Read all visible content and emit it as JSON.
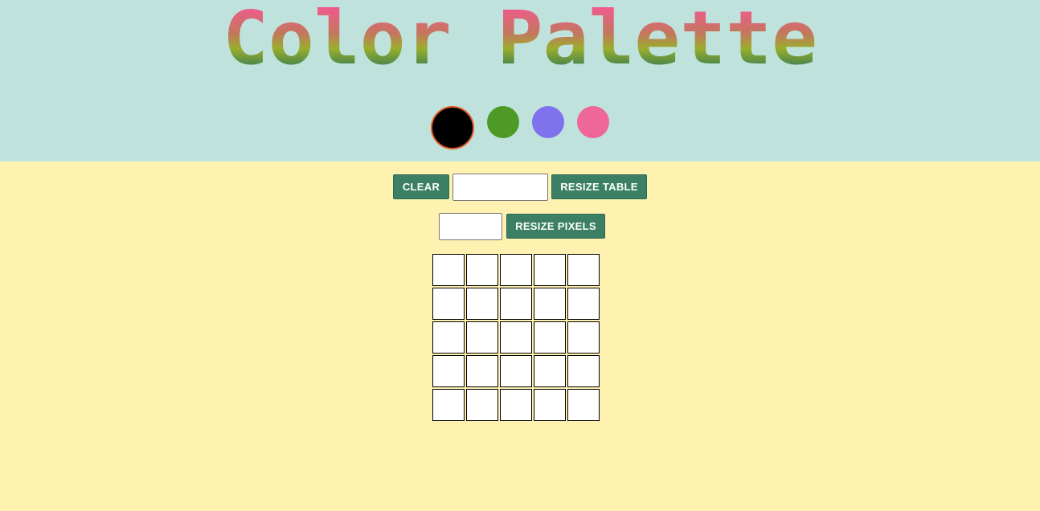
{
  "header": {
    "title": "Color Palette",
    "title_gradient": [
      "#ef5b8c",
      "#9aae2c",
      "#3a7d60"
    ]
  },
  "palette": {
    "colors": [
      "#000000",
      "#4d9b26",
      "#7f72ec",
      "#ef6698"
    ],
    "selected_index": 0,
    "selected_border": "#e05a2d"
  },
  "controls": {
    "clear_label": "CLEAR",
    "table_size_value": "",
    "resize_table_label": "RESIZE TABLE",
    "pixel_size_value": "",
    "resize_pixels_label": "RESIZE PIXELS"
  },
  "grid": {
    "rows": 5,
    "cols": 5,
    "cell_color": "#ffffff"
  },
  "theme": {
    "header_bg": "#bfe3dc",
    "body_bg": "#fff1b0",
    "button_bg": "#3b8064"
  }
}
